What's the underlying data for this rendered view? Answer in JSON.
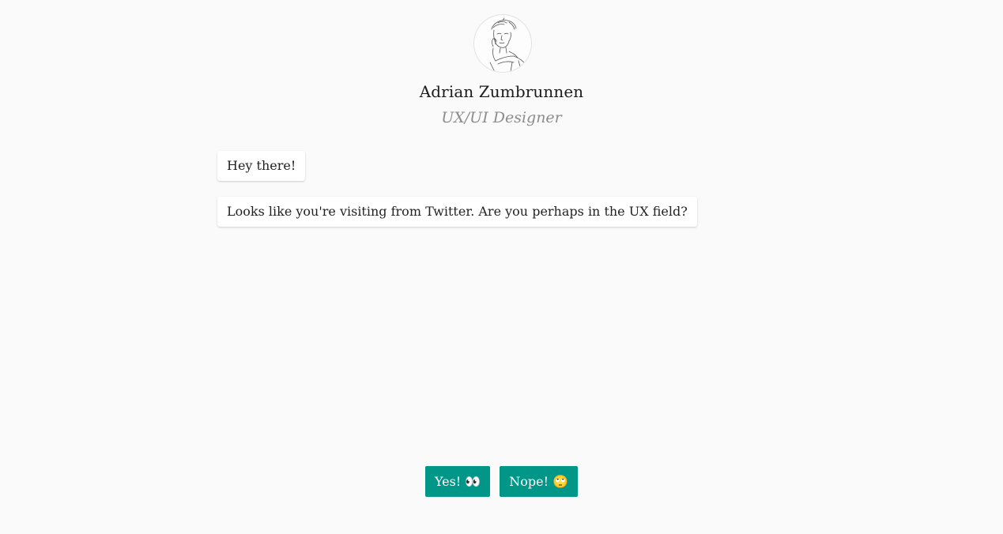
{
  "profile": {
    "name": "Adrian Zumbrunnen",
    "role": "UX/UI Designer"
  },
  "messages": [
    {
      "text": "Hey there!"
    },
    {
      "text": "Looks like you're visiting from Twitter. Are you perhaps in the UX field?"
    }
  ],
  "actions": {
    "yes_label": "Yes! 👀",
    "no_label": "Nope! 🙄"
  },
  "colors": {
    "background": "#fafafa",
    "button": "#009688",
    "role_text": "#8c8c8c"
  }
}
